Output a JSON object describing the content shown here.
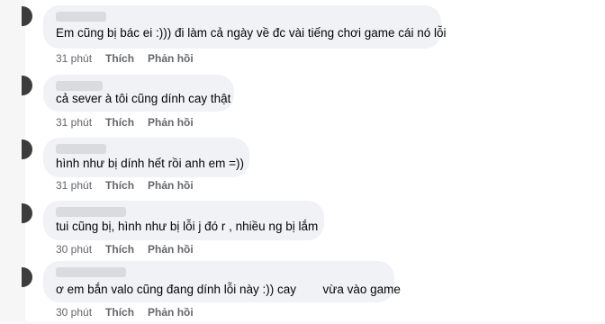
{
  "comments": [
    {
      "text": "Em cũng bị bác ei :))) đi làm cả ngày về đc vài tiếng chơi game cái nó lỗi",
      "time": "31 phút",
      "like": "Thích",
      "reply": "Phản hồi"
    },
    {
      "text": "cả sever à tôi cũng dính cay thật",
      "time": "31 phút",
      "like": "Thích",
      "reply": "Phản hồi"
    },
    {
      "text": "hình như bị dính hết rồi anh em =))",
      "time": "31 phút",
      "like": "Thích",
      "reply": "Phản hồi"
    },
    {
      "text": "tui cũng bị, hình như bị lỗi j đó r , nhiều ng bị lắm",
      "time": "30 phút",
      "like": "Thích",
      "reply": "Phản hồi"
    },
    {
      "text_a": "ơ em bắn valo cũng đang dính lỗi này :)) cay",
      "text_b": "vừa vào game",
      "time": "30 phút",
      "like": "Thích",
      "reply": "Phản hồi"
    }
  ]
}
